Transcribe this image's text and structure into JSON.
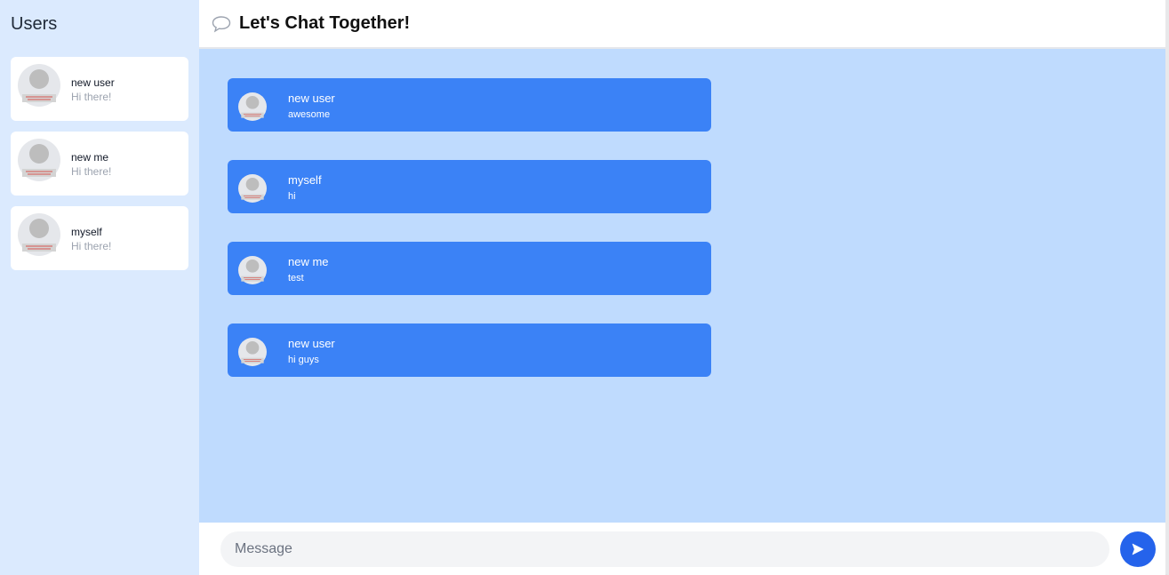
{
  "sidebar": {
    "title": "Users",
    "users": [
      {
        "name": "new user",
        "preview": "Hi there!",
        "icon": "avatar-placeholder-icon"
      },
      {
        "name": "new me",
        "preview": "Hi there!",
        "icon": "avatar-placeholder-icon"
      },
      {
        "name": "myself",
        "preview": "Hi there!",
        "icon": "avatar-placeholder-icon"
      }
    ]
  },
  "header": {
    "icon": "chat-bubble-icon",
    "title": "Let's Chat Together!"
  },
  "messages": [
    {
      "sender": "new user",
      "text": "awesome"
    },
    {
      "sender": "myself",
      "text": "hi"
    },
    {
      "sender": "new me",
      "text": "test"
    },
    {
      "sender": "new user",
      "text": "hi guys"
    }
  ],
  "composer": {
    "placeholder": "Message",
    "value": "",
    "send_icon": "send-icon"
  },
  "colors": {
    "sidebar_bg": "#dbeafe",
    "chat_bg": "#bfdbfe",
    "message_bubble": "#3b82f6",
    "send_button": "#2563eb"
  }
}
